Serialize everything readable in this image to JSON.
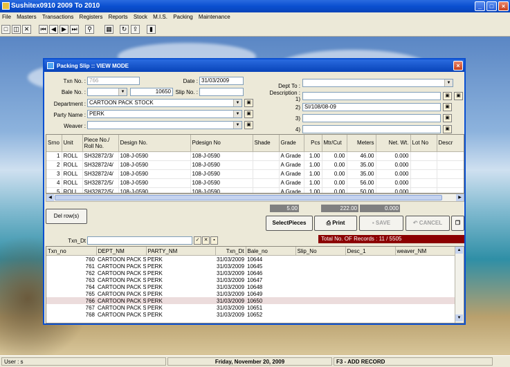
{
  "app": {
    "title": "Sushitex0910    2009  To  2010"
  },
  "menu": [
    "File",
    "Masters",
    "Transactions",
    "Registers",
    "Reports",
    "Stock",
    "M.I.S.",
    "Packing",
    "Maintenance"
  ],
  "status": {
    "user": "User : s",
    "date": "Friday, November 20, 2009",
    "hint": "F3 - ADD RECORD"
  },
  "dialog": {
    "title": "Packing Slip :: VIEW MODE",
    "labels": {
      "txn_no": "Txn No. :",
      "bale_no": "Bale No. :",
      "department": "Department :",
      "party_name": "Party Name :",
      "weaver": "Weaver :",
      "date": "Date :",
      "slip_no": "Slip No. :",
      "dept_to": "Dept To :",
      "description": "Description :",
      "d1": "1)",
      "d2": "2)",
      "d3": "3)",
      "d4": "4)"
    },
    "values": {
      "txn_no": "766",
      "bale_no": "10650",
      "date": "31/03/2009",
      "department": "CARTOON PACK STOCK",
      "party_name": "PERK",
      "weaver": "",
      "slip_no": "",
      "dept_to": "",
      "desc1": "",
      "desc2": "SI/108/08-09",
      "desc3": "",
      "desc4": ""
    },
    "grid_headers": [
      "Srno",
      "Unit",
      "Piece No./ Roll No.",
      "Design No.",
      "Pdesign No",
      "Shade",
      "Grade",
      "Pcs",
      "Mtr/Cut",
      "Meters",
      "Net. Wt.",
      "Lot No",
      "Descr"
    ],
    "grid_rows": [
      [
        "1",
        "ROLL",
        "SH32872/3/",
        "108-J-0590",
        "108-J-0590",
        "",
        "A Grade",
        "1.00",
        "0.00",
        "46.00",
        "0.000",
        "",
        ""
      ],
      [
        "2",
        "ROLL",
        "SH32872/4/",
        "108-J-0590",
        "108-J-0590",
        "",
        "A Grade",
        "1.00",
        "0.00",
        "35.00",
        "0.000",
        "",
        ""
      ],
      [
        "3",
        "ROLL",
        "SH32872/4/",
        "108-J-0590",
        "108-J-0590",
        "",
        "A Grade",
        "1.00",
        "0.00",
        "35.00",
        "0.000",
        "",
        ""
      ],
      [
        "4",
        "ROLL",
        "SH32872/5/",
        "108-J-0590",
        "108-J-0590",
        "",
        "A Grade",
        "1.00",
        "0.00",
        "56.00",
        "0.000",
        "",
        ""
      ],
      [
        "5",
        "ROLL",
        "SH32872/5/",
        "108-J-0590",
        "108-J-0590",
        "",
        "A Grade",
        "1.00",
        "0.00",
        "50.00",
        "0.000",
        "",
        ""
      ]
    ],
    "totals": {
      "pcs": "5.00",
      "meters": "222.00",
      "net_wt": "0.000"
    },
    "buttons": {
      "del_rows": "Del row(s)",
      "select_pieces": "SelectPieces",
      "print": "Print",
      "save": "SAVE",
      "cancel": "CANCEL"
    },
    "search": {
      "label": "Txn_Dt",
      "value": ""
    },
    "records": "Total No. OF Records : 11 / 5505",
    "list_headers": [
      "Txn_no",
      "DEPT_NM",
      "PARTY_NM",
      "Txn_Dt",
      "Bale_no",
      "Slip_No",
      "Desc_1",
      "weaver_NM"
    ],
    "list_rows": [
      [
        "760",
        "CARTOON PACK S",
        "PERK",
        "31/03/2009",
        "10644",
        "",
        "",
        ""
      ],
      [
        "761",
        "CARTOON PACK S",
        "PERK",
        "31/03/2009",
        "10645",
        "",
        "",
        ""
      ],
      [
        "762",
        "CARTOON PACK S",
        "PERK",
        "31/03/2009",
        "10646",
        "",
        "",
        ""
      ],
      [
        "763",
        "CARTOON PACK S",
        "PERK",
        "31/03/2009",
        "10647",
        "",
        "",
        ""
      ],
      [
        "764",
        "CARTOON PACK S",
        "PERK",
        "31/03/2009",
        "10648",
        "",
        "",
        ""
      ],
      [
        "765",
        "CARTOON PACK S",
        "PERK",
        "31/03/2009",
        "10649",
        "",
        "",
        ""
      ],
      [
        "766",
        "CARTOON PACK S",
        "PERK",
        "31/03/2009",
        "10650",
        "",
        "",
        ""
      ],
      [
        "767",
        "CARTOON PACK S",
        "PERK",
        "31/03/2009",
        "10651",
        "",
        "",
        ""
      ],
      [
        "768",
        "CARTOON PACK S",
        "PERK",
        "31/03/2009",
        "10652",
        "",
        "",
        ""
      ]
    ],
    "selected_list_row": 6
  }
}
